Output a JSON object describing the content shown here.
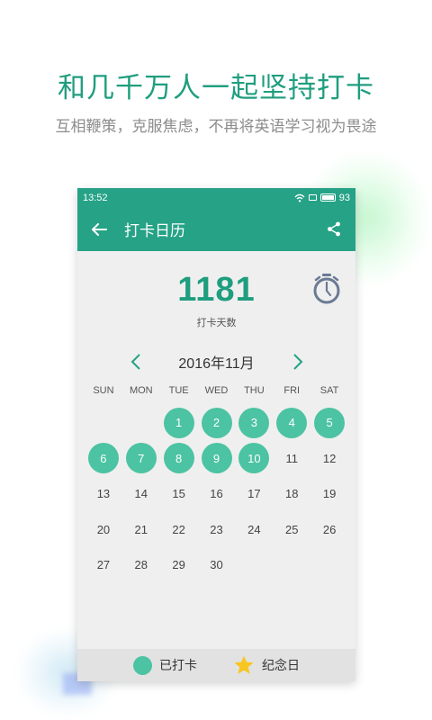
{
  "promo": {
    "title": "和几千万人一起坚持打卡",
    "subtitle": "互相鞭策，克服焦虑，不再将英语学习视为畏途"
  },
  "status_bar": {
    "time": "13:52",
    "battery": "93",
    "icons": [
      "wifi-icon",
      "screen-icon",
      "battery-icon"
    ]
  },
  "toolbar": {
    "title": "打卡日历",
    "back_icon": "back-arrow-icon",
    "share_icon": "share-icon"
  },
  "stats": {
    "count": "1181",
    "label": "打卡天数",
    "icon": "stopwatch-icon"
  },
  "calendar": {
    "month": "2016年11月",
    "weekdays": [
      "SUN",
      "MON",
      "TUE",
      "WED",
      "THU",
      "FRI",
      "SAT"
    ],
    "weeks": [
      [
        "",
        "",
        "1",
        "2",
        "3",
        "4",
        "5"
      ],
      [
        "6",
        "7",
        "8",
        "9",
        "10",
        "11",
        "12"
      ],
      [
        "13",
        "14",
        "15",
        "16",
        "17",
        "18",
        "19"
      ],
      [
        "20",
        "21",
        "22",
        "23",
        "24",
        "25",
        "26"
      ],
      [
        "27",
        "28",
        "29",
        "30",
        "",
        "",
        ""
      ]
    ],
    "checked_days": [
      "1",
      "2",
      "3",
      "4",
      "5",
      "6",
      "7",
      "8",
      "9",
      "10"
    ]
  },
  "legend": {
    "checked_label": "已打卡",
    "anniversary_label": "纪念日"
  },
  "colors": {
    "brand": "#26a286",
    "checked": "#4cc3a2",
    "accent_text": "#1f9e7f",
    "star": "#f7c623"
  }
}
